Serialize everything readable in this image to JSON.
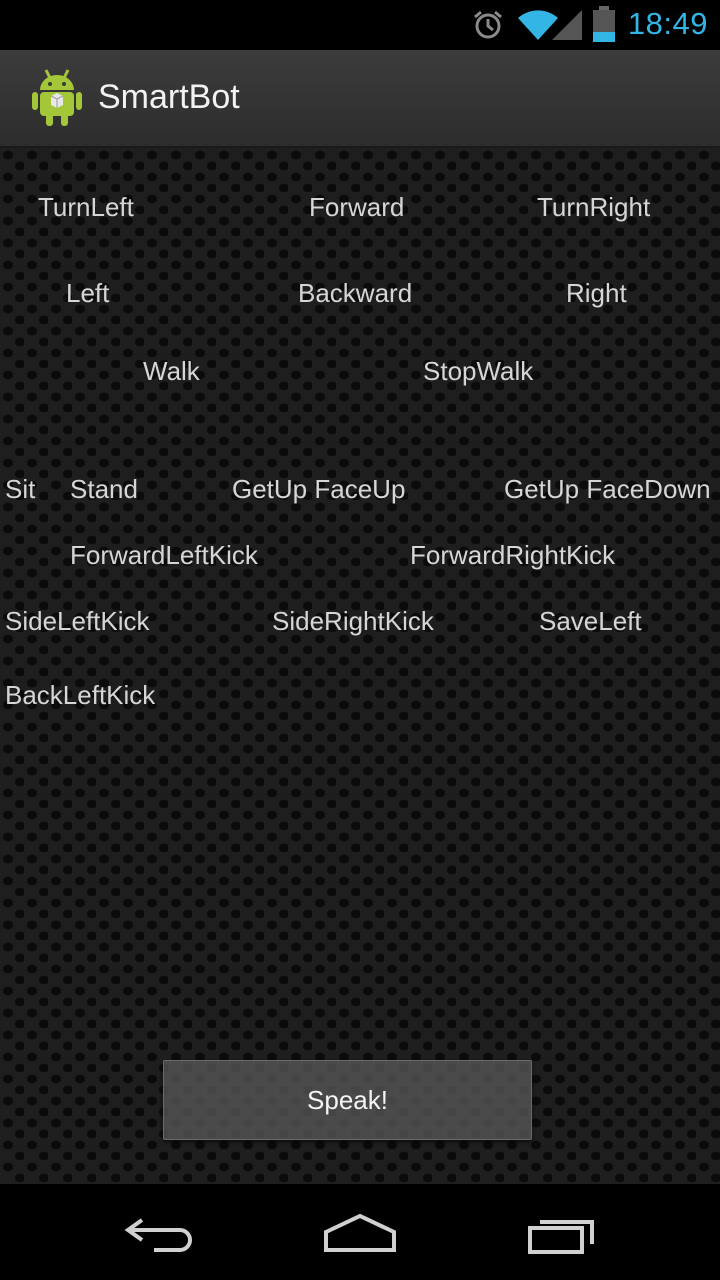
{
  "status_bar": {
    "time": "18:49",
    "icons": [
      "alarm-icon",
      "wifi-icon",
      "signal-icon",
      "battery-icon"
    ],
    "accent_color": "#33b5e5"
  },
  "action_bar": {
    "title": "SmartBot",
    "icon": "android-icon"
  },
  "commands": {
    "turn_left": "TurnLeft",
    "forward": "Forward",
    "turn_right": "TurnRight",
    "left": "Left",
    "backward": "Backward",
    "right": "Right",
    "walk": "Walk",
    "stop_walk": "StopWalk",
    "sit": "Sit",
    "stand": "Stand",
    "getup_faceup": "GetUp FaceUp",
    "getup_facedown": "GetUp FaceDown",
    "forward_left_kick": "ForwardLeftKick",
    "forward_right_kick": "ForwardRightKick",
    "side_left_kick": "SideLeftKick",
    "side_right_kick": "SideRightKick",
    "save_left": "SaveLeft",
    "back_left_kick": "BackLeftKick"
  },
  "speak_button": {
    "label": "Speak!"
  },
  "nav_bar": {
    "icons": [
      "back-icon",
      "home-icon",
      "recent-apps-icon"
    ]
  }
}
